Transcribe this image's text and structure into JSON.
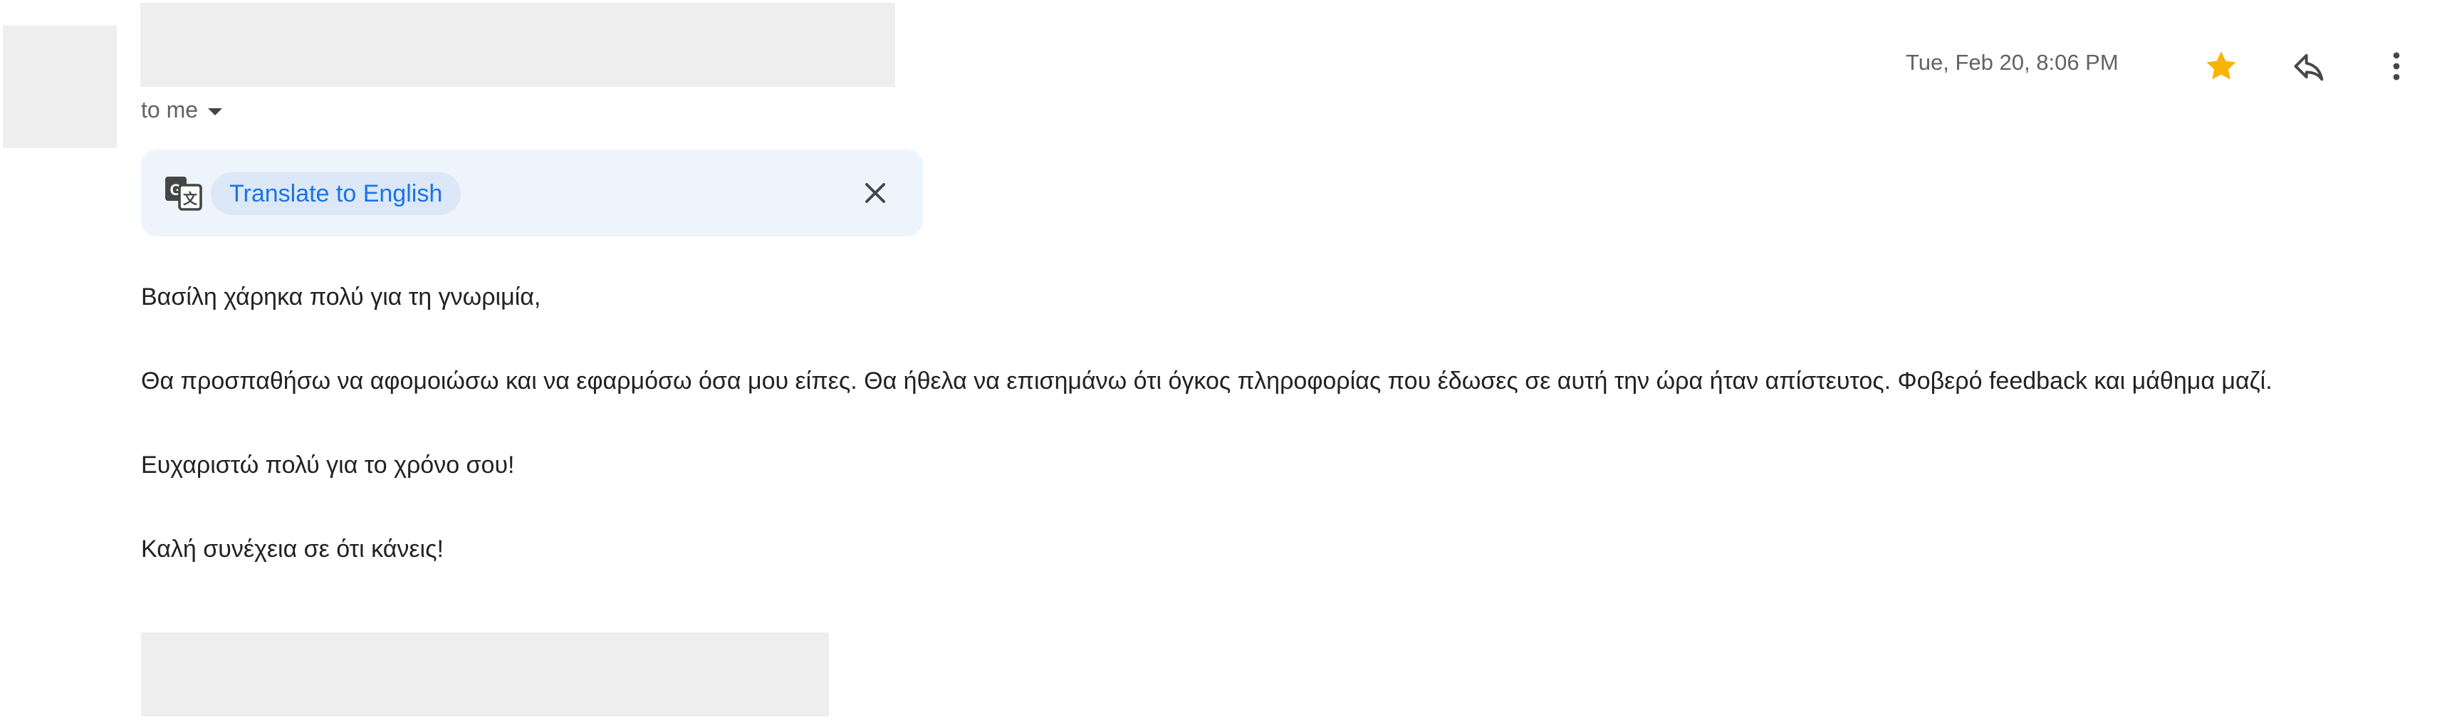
{
  "recipient": {
    "label": "to me"
  },
  "header": {
    "date": "Tue, Feb 20, 8:06 PM",
    "icons": {
      "star": "star-icon",
      "reply": "reply-icon",
      "more": "more-vert-icon"
    },
    "colors": {
      "star": "#f6b400",
      "icon": "#444746"
    }
  },
  "translate_bar": {
    "button_label": "Translate to English",
    "icon": "translate-icon",
    "close_icon": "close-icon",
    "colors": {
      "background": "#eef4fb",
      "chip_background": "#dce8f7",
      "chip_text": "#1a73e8"
    }
  },
  "message": {
    "greeting": "Βασίλη χάρηκα πολύ για τη γνωριμία,",
    "paragraph_1": "Θα προσπαθήσω να αφομοιώσω και να εφαρμόσω όσα μου είπες. Θα ήθελα να επισημάνω ότι όγκος πληροφορίας που έδωσες σε αυτή την ώρα ήταν απίστευτος. Φοβερό feedback και μάθημα μαζί.",
    "paragraph_2": "Ευχαριστώ πολύ για το χρόνο σου!",
    "paragraph_3": "Καλή συνέχεια σε ότι κάνεις!"
  }
}
